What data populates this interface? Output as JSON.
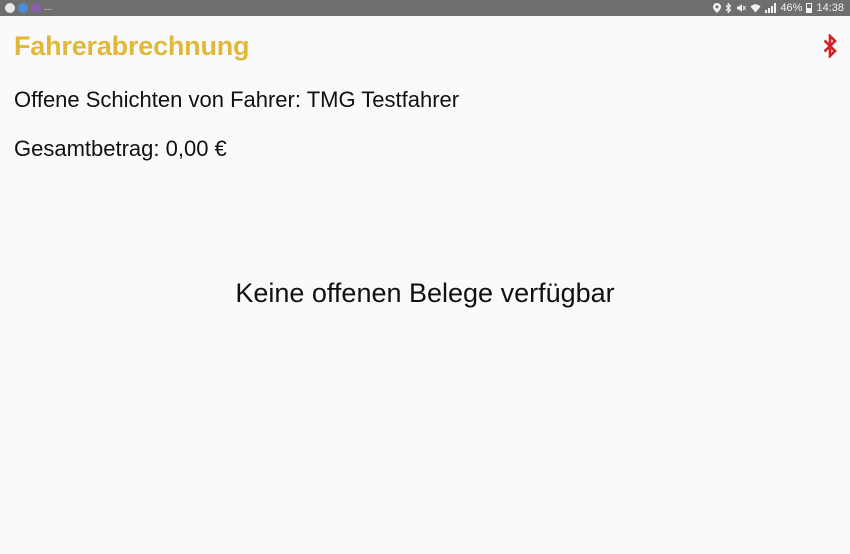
{
  "status_bar": {
    "overflow": "...",
    "battery": "46%",
    "time": "14:38",
    "icons_left": [
      "notification-icon",
      "app-icon",
      "app-icon-2"
    ],
    "icons_right": [
      "location-icon",
      "bluetooth-icon",
      "mute-icon",
      "wifi-icon",
      "signal-icon",
      "battery-icon"
    ]
  },
  "header": {
    "title": "Fahrerabrechnung",
    "title_color": "#e0b93a",
    "bluetooth_icon_color": "#d42020"
  },
  "content": {
    "shifts_line": "Offene Schichten von Fahrer: TMG Testfahrer",
    "total_line": "Gesamtbetrag: 0,00 €",
    "empty_message": "Keine offenen Belege verfügbar"
  }
}
